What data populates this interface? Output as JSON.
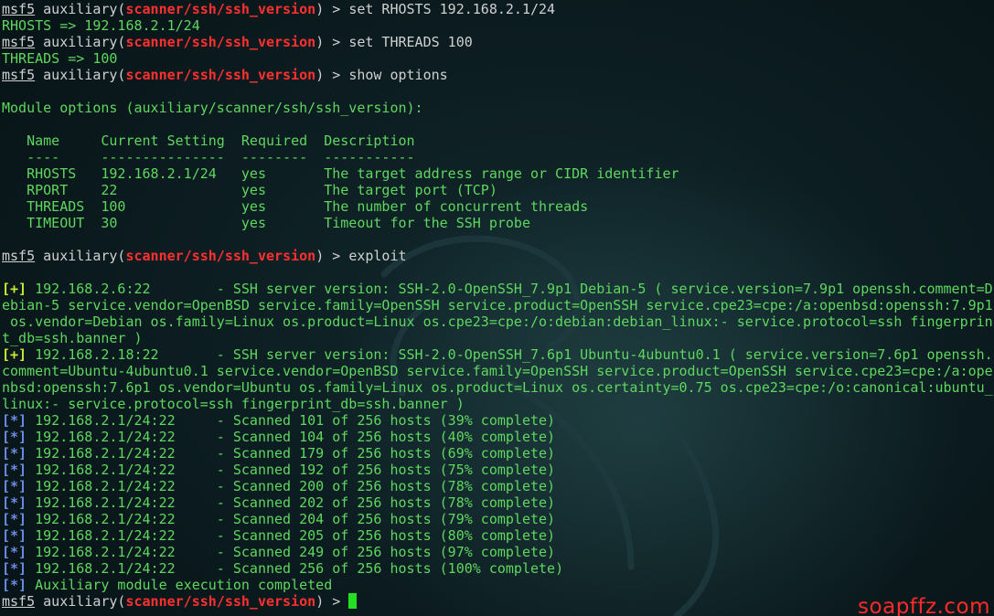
{
  "prompt": {
    "msf": "msf5",
    "aux": " auxiliary(",
    "module": "scanner/ssh/ssh_version",
    "close": ") > "
  },
  "lines": [
    {
      "kind": "prompt",
      "cmd": "set RHOSTS 192.168.2.1/24"
    },
    {
      "kind": "out",
      "text": "RHOSTS => 192.168.2.1/24"
    },
    {
      "kind": "prompt",
      "cmd": "set THREADS 100"
    },
    {
      "kind": "out",
      "text": "THREADS => 100"
    },
    {
      "kind": "prompt",
      "cmd": "show options"
    },
    {
      "kind": "blank"
    },
    {
      "kind": "out",
      "text": "Module options (auxiliary/scanner/ssh/ssh_version):"
    },
    {
      "kind": "blank"
    },
    {
      "kind": "out",
      "text": "   Name     Current Setting  Required  Description"
    },
    {
      "kind": "out",
      "text": "   ----     ---------------  --------  -----------"
    },
    {
      "kind": "out",
      "text": "   RHOSTS   192.168.2.1/24   yes       The target address range or CIDR identifier"
    },
    {
      "kind": "out",
      "text": "   RPORT    22               yes       The target port (TCP)"
    },
    {
      "kind": "out",
      "text": "   THREADS  100              yes       The number of concurrent threads"
    },
    {
      "kind": "out",
      "text": "   TIMEOUT  30               yes       Timeout for the SSH probe"
    },
    {
      "kind": "blank"
    },
    {
      "kind": "prompt",
      "cmd": "exploit"
    },
    {
      "kind": "blank"
    },
    {
      "kind": "tagged",
      "tag": "[+]",
      "tagtype": "good",
      "text": " 192.168.2.6:22        - SSH server version: SSH-2.0-OpenSSH_7.9p1 Debian-5 ( service.version=7.9p1 openssh.comment=D"
    },
    {
      "kind": "out",
      "text": "ebian-5 service.vendor=OpenBSD service.family=OpenSSH service.product=OpenSSH service.cpe23=cpe:/a:openbsd:openssh:7.9p1"
    },
    {
      "kind": "out",
      "text": " os.vendor=Debian os.family=Linux os.product=Linux os.cpe23=cpe:/o:debian:debian_linux:- service.protocol=ssh fingerprin"
    },
    {
      "kind": "out",
      "text": "t_db=ssh.banner )"
    },
    {
      "kind": "tagged",
      "tag": "[+]",
      "tagtype": "good",
      "text": " 192.168.2.18:22       - SSH server version: SSH-2.0-OpenSSH_7.6p1 Ubuntu-4ubuntu0.1 ( service.version=7.6p1 openssh."
    },
    {
      "kind": "out",
      "text": "comment=Ubuntu-4ubuntu0.1 service.vendor=OpenBSD service.family=OpenSSH service.product=OpenSSH service.cpe23=cpe:/a:ope"
    },
    {
      "kind": "out",
      "text": "nbsd:openssh:7.6p1 os.vendor=Ubuntu os.family=Linux os.product=Linux os.certainty=0.75 os.cpe23=cpe:/o:canonical:ubuntu_"
    },
    {
      "kind": "out",
      "text": "linux:- service.protocol=ssh fingerprint_db=ssh.banner )"
    },
    {
      "kind": "tagged",
      "tag": "[*]",
      "tagtype": "info",
      "text": " 192.168.2.1/24:22     - Scanned 101 of 256 hosts (39% complete)"
    },
    {
      "kind": "tagged",
      "tag": "[*]",
      "tagtype": "info",
      "text": " 192.168.2.1/24:22     - Scanned 104 of 256 hosts (40% complete)"
    },
    {
      "kind": "tagged",
      "tag": "[*]",
      "tagtype": "info",
      "text": " 192.168.2.1/24:22     - Scanned 179 of 256 hosts (69% complete)"
    },
    {
      "kind": "tagged",
      "tag": "[*]",
      "tagtype": "info",
      "text": " 192.168.2.1/24:22     - Scanned 192 of 256 hosts (75% complete)"
    },
    {
      "kind": "tagged",
      "tag": "[*]",
      "tagtype": "info",
      "text": " 192.168.2.1/24:22     - Scanned 200 of 256 hosts (78% complete)"
    },
    {
      "kind": "tagged",
      "tag": "[*]",
      "tagtype": "info",
      "text": " 192.168.2.1/24:22     - Scanned 202 of 256 hosts (78% complete)"
    },
    {
      "kind": "tagged",
      "tag": "[*]",
      "tagtype": "info",
      "text": " 192.168.2.1/24:22     - Scanned 204 of 256 hosts (79% complete)"
    },
    {
      "kind": "tagged",
      "tag": "[*]",
      "tagtype": "info",
      "text": " 192.168.2.1/24:22     - Scanned 205 of 256 hosts (80% complete)"
    },
    {
      "kind": "tagged",
      "tag": "[*]",
      "tagtype": "info",
      "text": " 192.168.2.1/24:22     - Scanned 249 of 256 hosts (97% complete)"
    },
    {
      "kind": "tagged",
      "tag": "[*]",
      "tagtype": "info",
      "text": " 192.168.2.1/24:22     - Scanned 256 of 256 hosts (100% complete)"
    },
    {
      "kind": "tagged",
      "tag": "[*]",
      "tagtype": "info",
      "text": " Auxiliary module execution completed"
    },
    {
      "kind": "prompt",
      "cmd": "",
      "cursor": true
    }
  ],
  "watermark": "soapffz.com",
  "colors": {
    "background": "#0a1a1e",
    "output_green": "#5fd75f",
    "module_red": "#ff3030",
    "good_tag": "#c8e836",
    "info_tag": "#6a8ce8",
    "cursor": "#22e022",
    "watermark": "#ff2a2a"
  },
  "icons": {
    "background_art": "kali-dragon-icon",
    "cursor": "block-cursor-icon"
  }
}
